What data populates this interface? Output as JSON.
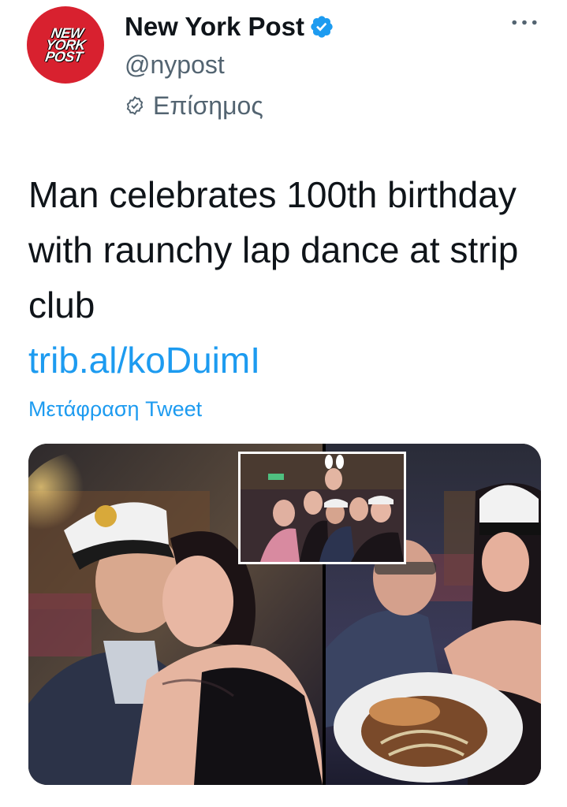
{
  "account": {
    "avatar_logo_lines": [
      "NEW",
      "YORK",
      "POST"
    ],
    "display_name": "New York Post",
    "handle": "@nypost",
    "official_label": "Επίσημος",
    "verified_icon": "verified-badge-icon",
    "official_icon": "official-check-icon"
  },
  "tweet": {
    "text": "Man celebrates 100th birthday with raunchy lap dance at strip club",
    "link": "trib.al/koDuimI",
    "translate_label": "Μετάφραση Tweet"
  },
  "media": {
    "count": 3,
    "photos": [
      "photo-kiss",
      "photo-group-inset",
      "photo-eating"
    ]
  },
  "colors": {
    "brand_red": "#d8212f",
    "link_blue": "#1d9bf0",
    "secondary_text": "#536471",
    "primary_text": "#0f1419"
  }
}
